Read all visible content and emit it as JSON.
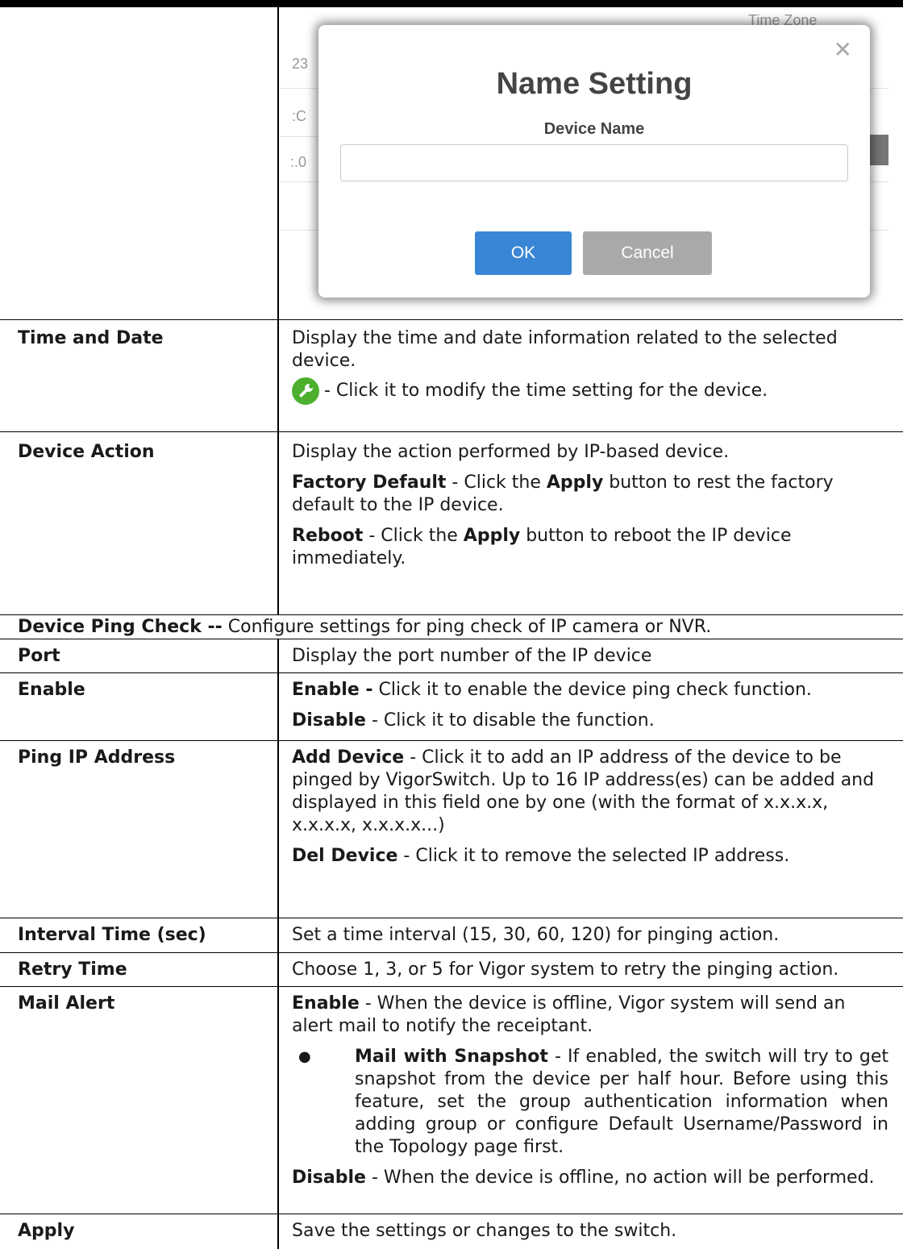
{
  "modal": {
    "bg_texts": [
      "Time Zone",
      "23",
      ":C",
      ":.0"
    ],
    "title": "Name Setting",
    "label": "Device Name",
    "input_value": "",
    "ok_label": "OK",
    "cancel_label": "Cancel",
    "close_icon": "close-icon"
  },
  "rows": {
    "time_date": {
      "label": "Time and Date",
      "desc": "Display the time and date information related to the selected device.",
      "icon": "wrench-icon",
      "icon_desc": "- Click it to modify the time setting for the device."
    },
    "device_action": {
      "label": "Device Action",
      "desc": "Display the action performed by IP-based device.",
      "factory_b": "Factory Default",
      "factory_t1": " - Click the ",
      "factory_apply": "Apply",
      "factory_t2": " button to rest the factory default to the IP device.",
      "reboot_b": "Reboot",
      "reboot_t1": " - Click the ",
      "reboot_apply": "Apply",
      "reboot_t2": " button to reboot the IP device immediately."
    },
    "ping_check": {
      "label": "Device Ping Check --",
      "desc": " Configure settings for ping check of IP camera or NVR."
    },
    "port": {
      "label": "Port",
      "desc": "Display the port number of the IP device"
    },
    "enable": {
      "label": "Enable",
      "enable_b": "Enable -",
      "enable_t": " Click it to enable the device ping check function.",
      "disable_b": "Disable",
      "disable_t": " - Click it to disable the function."
    },
    "ping_ip": {
      "label": "Ping IP Address",
      "add_b": "Add Device",
      "add_t": " - Click it to add an IP address of the device to be pinged by VigorSwitch. Up to 16 IP address(es) can be  added and displayed in this field one by one (with the format of x.x.x.x, x.x.x.x, x.x.x.x...)",
      "del_b": "Del Device",
      "del_t": " - Click it to remove the selected IP address."
    },
    "interval": {
      "label": "Interval Time (sec)",
      "desc": "Set a time interval (15, 30, 60, 120) for pinging action."
    },
    "retry": {
      "label": "Retry Time",
      "desc": "Choose 1, 3, or 5 for Vigor system to retry the pinging action."
    },
    "mail": {
      "label": "Mail Alert",
      "enable_b": "Enable",
      "enable_t": " - When the device is offline, Vigor system will send an alert mail to notify the receiptant.",
      "bullet": "●",
      "snap_b": "Mail with Snapshot",
      "snap_t": " - If enabled, the switch will try to get snapshot from the device per half hour. Before using this feature, set the group authentication information when adding group or configure Default Username/Password in the Topology page first.",
      "disable_b": "Disable",
      "disable_t": " - When the device is offline, no action will be performed."
    },
    "apply": {
      "label": "Apply",
      "desc": "Save the settings or changes to the switch."
    }
  }
}
